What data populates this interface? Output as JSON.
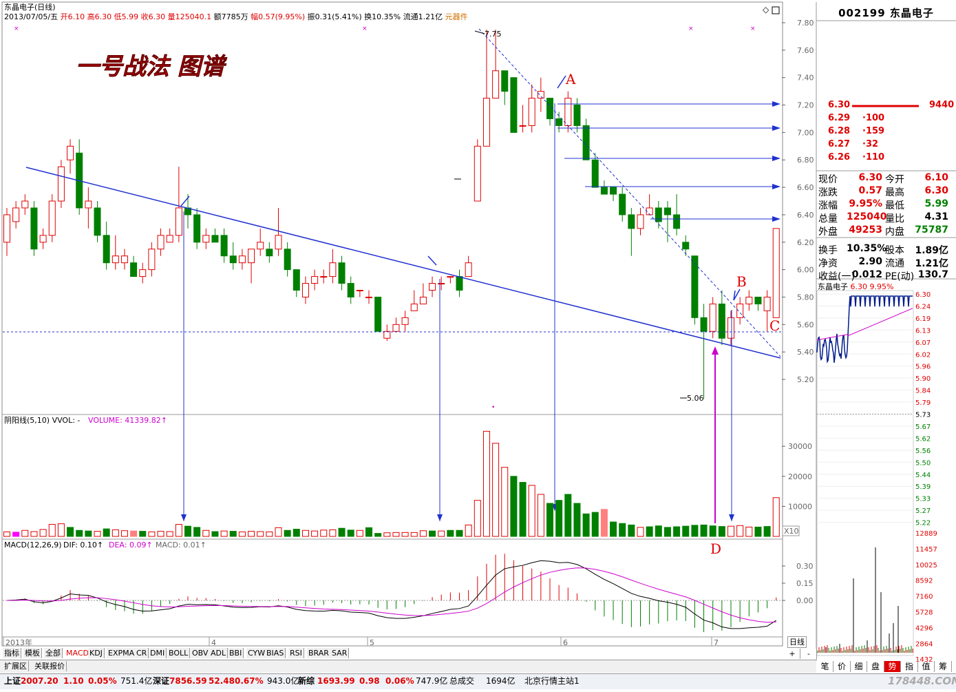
{
  "header": {
    "title": "东晶电子(日线)",
    "date": "2013/07/05/五",
    "open_label": "开",
    "open": "6.10",
    "high_label": "高",
    "high": "6.30",
    "low_label": "低",
    "low": "5.99",
    "close_label": "收",
    "close": "6.30",
    "volume_label": "量",
    "volume": "125040.1",
    "amount_label": "额",
    "amount": "7785万",
    "change_label": "幅",
    "change": "0.57(9.95%)",
    "amplitude_label": "振",
    "amplitude": "0.31(5.41%)",
    "turnover_label": "换",
    "turnover": "10.35%",
    "float_label": "流通",
    "float": "1.21亿",
    "sector": "元器件"
  },
  "annotations": {
    "title": "一号战法 图谱",
    "A": "A",
    "B": "B",
    "C": "C",
    "D": "D",
    "high_mark": "7.75",
    "low_mark": "5.06"
  },
  "volume_panel": {
    "label": "阴阳线(5,10) VVOL: -",
    "volume_text": "VOLUME: 41339.82↑",
    "scale_tag": "X10"
  },
  "macd_panel": {
    "label": "MACD(12,26,9)",
    "dif": "DIF: 0.10↑",
    "dea": "DEA: 0.09↑",
    "macd": "MACD: 0.01↑"
  },
  "x_axis_labels": [
    "2013年",
    "4",
    "5",
    "6",
    "7"
  ],
  "price_axis": [
    "7.80",
    "7.60",
    "7.40",
    "7.20",
    "7.00",
    "6.80",
    "6.60",
    "6.40",
    "6.20",
    "6.00",
    "5.80",
    "5.60",
    "5.40",
    "5.20"
  ],
  "volume_axis": [
    "30000",
    "20000",
    "10000"
  ],
  "macd_axis": [
    "0.30",
    "0.15",
    "0.00"
  ],
  "bottom_tabs": [
    "指标",
    "模板",
    "全部",
    "MACD",
    "KDJ",
    "EXPMA",
    "CR",
    "DMI",
    "BOLL",
    "OBV",
    "ADL",
    "BBI",
    "CYW",
    "BIAS",
    "RSI",
    "BRAR",
    "SAR"
  ],
  "bottom_subtabs": [
    "扩展区",
    "关联报价"
  ],
  "period_label": "日线",
  "right_panel": {
    "code": "002199",
    "name": "东晶电子",
    "order_book": [
      {
        "price": "6.30",
        "vol": "9440"
      },
      {
        "price": "6.29",
        "vol": "100"
      },
      {
        "price": "6.28",
        "vol": "159"
      },
      {
        "price": "6.27",
        "vol": "32"
      },
      {
        "price": "6.26",
        "vol": "110"
      }
    ],
    "quote": [
      {
        "l1": "现价",
        "v1": "6.30",
        "l2": "今开",
        "v2": "6.10"
      },
      {
        "l1": "涨跌",
        "v1": "0.57",
        "l2": "最高",
        "v2": "6.30"
      },
      {
        "l1": "涨幅",
        "v1": "9.95%",
        "l2": "最低",
        "v2": "5.99"
      },
      {
        "l1": "总量",
        "v1": "125040",
        "l2": "量比",
        "v2": "4.31"
      },
      {
        "l1": "外盘",
        "v1": "49253",
        "l2": "内盘",
        "v2": "75787"
      },
      {
        "l1": "换手",
        "v1": "10.35%",
        "l2": "股本",
        "v2": "1.89亿"
      },
      {
        "l1": "净资",
        "v1": "2.90",
        "l2": "流通",
        "v2": "1.21亿"
      },
      {
        "l1": "收益(一)",
        "v1": "0.012",
        "l2": "PE(动)",
        "v2": "130.7"
      }
    ],
    "mini_title": "东晶电子",
    "mini_price": "6.30",
    "mini_change": "9.95%",
    "mini_axis": [
      "6.30",
      "6.24",
      "6.19",
      "6.13",
      "6.07",
      "6.02",
      "5.96",
      "5.90",
      "5.84",
      "5.79",
      "5.73",
      "5.67",
      "5.62",
      "5.56",
      "5.50",
      "5.44",
      "5.39",
      "5.33",
      "5.27",
      "5.22"
    ],
    "mini_vol_axis": [
      "12889",
      "11457",
      "10025",
      "8592",
      "7160",
      "5728",
      "4296",
      "2864",
      "1432"
    ],
    "tabs": [
      "笔",
      "价",
      "细",
      "盘",
      "势",
      "指",
      "值",
      "筹"
    ]
  },
  "statusbar": {
    "sh_label": "上证",
    "sh": "2007.20",
    "sh_chg": "1.10",
    "sh_pct": "0.05%",
    "sh_amt": "751.4亿",
    "sz_label": "深证",
    "sz": "7856.59",
    "sz_chg": "52.48",
    "sz_pct": "0.67%",
    "sz_amt": "943.0亿",
    "new_label": "新综",
    "new": "1693.99",
    "new_chg": "0.98",
    "new_pct": "0.06%",
    "new_amt": "747.9亿",
    "total_label": "总成交",
    "total": "1694亿",
    "server": "北京行情主站1",
    "watermark": "178448.COM"
  },
  "chart_data": {
    "type": "candlestick",
    "title": "一号战法 图谱",
    "ylim": [
      5.0,
      7.85
    ],
    "candles": [
      [
        6.2,
        6.4,
        6.45,
        6.1
      ],
      [
        6.35,
        6.45,
        6.5,
        6.3
      ],
      [
        6.45,
        6.5,
        6.55,
        6.4
      ],
      [
        6.45,
        6.15,
        6.5,
        6.1
      ],
      [
        6.2,
        6.25,
        6.3,
        6.15
      ],
      [
        6.25,
        6.5,
        6.55,
        6.2
      ],
      [
        6.5,
        6.75,
        6.8,
        6.45
      ],
      [
        6.8,
        6.9,
        6.95,
        6.7
      ],
      [
        6.85,
        6.45,
        6.95,
        6.4
      ],
      [
        6.45,
        6.5,
        6.6,
        6.3
      ],
      [
        6.45,
        6.25,
        6.5,
        6.2
      ],
      [
        6.25,
        6.05,
        6.35,
        6.0
      ],
      [
        6.05,
        6.1,
        6.25,
        6.0
      ],
      [
        6.05,
        6.1,
        6.15,
        6.0
      ],
      [
        6.05,
        5.95,
        6.1,
        5.95
      ],
      [
        5.95,
        6.0,
        6.05,
        5.9
      ],
      [
        6.0,
        6.15,
        6.2,
        5.95
      ],
      [
        6.15,
        6.25,
        6.3,
        6.1
      ],
      [
        6.2,
        6.25,
        6.3,
        6.2
      ],
      [
        6.25,
        6.45,
        6.75,
        6.2
      ],
      [
        6.45,
        6.4,
        6.55,
        6.3
      ],
      [
        6.4,
        6.2,
        6.45,
        6.15
      ],
      [
        6.2,
        6.25,
        6.3,
        6.15
      ],
      [
        6.25,
        6.2,
        6.3,
        6.2
      ],
      [
        6.25,
        6.1,
        6.3,
        6.05
      ],
      [
        6.1,
        6.05,
        6.2,
        6.0
      ],
      [
        6.05,
        6.1,
        6.15,
        6.0
      ],
      [
        6.05,
        6.15,
        6.15,
        5.9
      ],
      [
        6.15,
        6.2,
        6.3,
        6.1
      ],
      [
        6.15,
        6.1,
        6.2,
        6.05
      ],
      [
        6.15,
        6.25,
        6.45,
        6.1
      ],
      [
        6.15,
        6.0,
        6.2,
        5.95
      ],
      [
        6.0,
        5.85,
        6.0,
        5.8
      ],
      [
        5.8,
        5.9,
        5.95,
        5.75
      ],
      [
        5.9,
        5.95,
        6.0,
        5.85
      ],
      [
        5.95,
        5.95,
        6.0,
        5.9
      ],
      [
        5.95,
        6.05,
        6.15,
        5.9
      ],
      [
        6.05,
        5.9,
        6.1,
        5.85
      ],
      [
        5.9,
        5.8,
        5.95,
        5.75
      ],
      [
        5.85,
        5.85,
        5.85,
        5.8
      ],
      [
        5.8,
        5.8,
        5.85,
        5.75
      ],
      [
        5.8,
        5.55,
        5.8,
        5.55
      ],
      [
        5.5,
        5.55,
        5.6,
        5.48
      ],
      [
        5.55,
        5.6,
        5.65,
        5.55
      ],
      [
        5.6,
        5.65,
        5.7,
        5.55
      ],
      [
        5.7,
        5.75,
        5.85,
        5.7
      ],
      [
        5.75,
        5.8,
        5.9,
        5.75
      ],
      [
        5.85,
        5.9,
        5.95,
        5.8
      ],
      [
        5.9,
        5.9,
        5.95,
        5.85
      ],
      [
        5.95,
        5.95,
        5.95,
        5.9
      ],
      [
        5.95,
        5.85,
        6.0,
        5.8
      ],
      [
        5.95,
        6.05,
        6.1,
        5.95
      ],
      [
        6.5,
        6.9,
        6.95,
        6.7
      ],
      [
        6.9,
        7.25,
        7.75,
        6.9
      ],
      [
        7.25,
        7.45,
        7.75,
        7.25
      ],
      [
        7.45,
        7.3,
        7.45,
        7.2
      ],
      [
        7.4,
        7.0,
        7.4,
        7.0
      ],
      [
        7.05,
        7.05,
        7.2,
        7.0
      ],
      [
        7.05,
        7.25,
        7.35,
        7.0
      ],
      [
        7.25,
        7.3,
        7.4,
        7.15
      ],
      [
        7.25,
        7.1,
        7.25,
        7.05
      ],
      [
        7.1,
        7.05,
        7.15,
        7.0
      ],
      [
        7.05,
        7.25,
        7.3,
        7.0
      ],
      [
        7.2,
        7.05,
        7.25,
        7.0
      ],
      [
        7.05,
        6.8,
        7.1,
        6.8
      ],
      [
        6.8,
        6.6,
        6.85,
        6.6
      ],
      [
        6.6,
        6.55,
        6.65,
        6.55
      ],
      [
        6.6,
        6.55,
        6.6,
        6.5
      ],
      [
        6.55,
        6.4,
        6.6,
        6.35
      ],
      [
        6.4,
        6.3,
        6.45,
        6.1
      ],
      [
        6.3,
        6.4,
        6.45,
        6.25
      ],
      [
        6.4,
        6.45,
        6.55,
        6.4
      ],
      [
        6.45,
        6.35,
        6.5,
        6.3
      ],
      [
        6.45,
        6.4,
        6.5,
        6.2
      ],
      [
        6.4,
        6.3,
        6.55,
        6.25
      ],
      [
        6.2,
        6.15,
        6.25,
        6.1
      ],
      [
        6.1,
        5.65,
        6.1,
        5.6
      ],
      [
        5.65,
        5.55,
        5.75,
        5.06
      ],
      [
        5.55,
        5.75,
        5.8,
        5.5
      ],
      [
        5.75,
        5.5,
        5.85,
        5.45
      ],
      [
        5.5,
        5.65,
        5.7,
        5.45
      ],
      [
        5.65,
        5.75,
        5.8,
        5.6
      ],
      [
        5.75,
        5.8,
        5.85,
        5.7
      ],
      [
        5.8,
        5.75,
        5.8,
        5.7
      ],
      [
        5.7,
        5.8,
        5.85,
        5.55
      ],
      [
        5.65,
        6.3,
        6.3,
        5.99
      ]
    ],
    "volume": [
      1500,
      1400,
      2000,
      1600,
      2300,
      4000,
      4200,
      3000,
      2000,
      1800,
      1700,
      2500,
      2200,
      1900,
      1800,
      1700,
      1500,
      1700,
      1600,
      4000,
      3400,
      3000,
      2000,
      1600,
      1800,
      1700,
      1500,
      1700,
      1600,
      1500,
      2900,
      2000,
      2400,
      2000,
      1800,
      2100,
      2200,
      2700,
      2100,
      2000,
      2900,
      1000,
      1200,
      1300,
      1300,
      1300,
      1900,
      1800,
      1800,
      2000,
      2000,
      3800,
      12000,
      35000,
      31000,
      23000,
      20000,
      18000,
      17000,
      14000,
      11000,
      12000,
      14000,
      11000,
      7500,
      8000,
      9000,
      4800,
      4300,
      3800,
      3000,
      3200,
      3500,
      3000,
      3200,
      3400,
      3700,
      3800,
      3500,
      3300,
      3400,
      3600,
      3100,
      3100,
      3300,
      12889
    ],
    "volume_colors": [
      "r",
      "mg",
      "r",
      "r",
      "r",
      "r",
      "r",
      "g",
      "g",
      "g",
      "r",
      "g",
      "r",
      "r",
      "pk",
      "g",
      "r",
      "r",
      "r",
      "r",
      "g",
      "g",
      "r",
      "g",
      "r",
      "g",
      "r",
      "r",
      "r",
      "r",
      "r",
      "g",
      "g",
      "r",
      "r",
      "r",
      "r",
      "g",
      "g",
      "r",
      "g",
      "g",
      "r",
      "r",
      "r",
      "r",
      "r",
      "g",
      "r",
      "g",
      "g",
      "r",
      "r",
      "r",
      "r",
      "r",
      "g",
      "g",
      "r",
      "r",
      "g",
      "g",
      "g",
      "g",
      "g",
      "g",
      "pk",
      "g",
      "g",
      "g",
      "r",
      "g",
      "g",
      "g",
      "g",
      "g",
      "g",
      "g",
      "g",
      "g",
      "r",
      "r",
      "r",
      "g",
      "g",
      "r"
    ],
    "macd": {
      "dif_range": [
        -0.25,
        0.35
      ],
      "series": [
        "DIF",
        "DEA",
        "MACD"
      ]
    }
  }
}
